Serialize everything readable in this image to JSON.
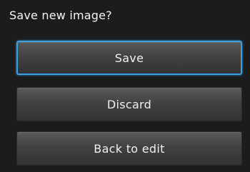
{
  "dialog": {
    "prompt": "Save new image?",
    "buttons": {
      "save": "Save",
      "discard": "Discard",
      "back": "Back to edit"
    },
    "selected": "save",
    "colors": {
      "background": "#1c1c1c",
      "selection_outline": "#3aa0e6"
    }
  }
}
